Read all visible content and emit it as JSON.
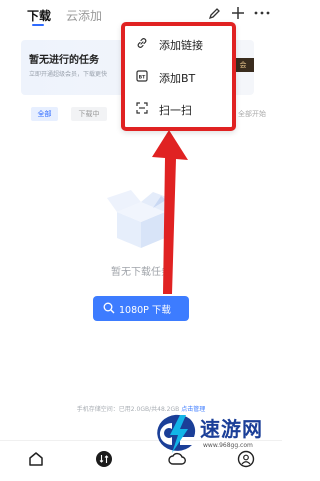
{
  "tabs": {
    "download": "下载",
    "cloud_add": "云添加"
  },
  "top_icons": {
    "edit": "edit-icon",
    "add": "plus-icon",
    "more": "more-icon"
  },
  "banner": {
    "title": "暂无进行的任务",
    "subtitle": "立即开通超级会员，下载更快",
    "button": "会"
  },
  "filters": {
    "all": "全部",
    "downloading": "下载中",
    "batch_start": "全部开始"
  },
  "popup_menu": {
    "items": [
      {
        "label": "添加链接",
        "icon": "link-icon"
      },
      {
        "label": "添加BT",
        "icon": "bt-icon"
      },
      {
        "label": "扫一扫",
        "icon": "scan-icon"
      }
    ]
  },
  "empty_state": {
    "text": "暂无下载任务",
    "button": "1080P 下载"
  },
  "storage": {
    "text": "手机存储空间：已用2.0GB/共48.2GB",
    "manage": "点击管理"
  },
  "bottom_nav": [
    "home-icon",
    "transfer-icon",
    "cloud-icon",
    "profile-icon"
  ],
  "watermark": {
    "title": "速游网",
    "url": "www.968gg.com"
  },
  "colors": {
    "accent": "#3d7cff",
    "annotation": "#e02222",
    "watermark": "#1b3f98"
  }
}
